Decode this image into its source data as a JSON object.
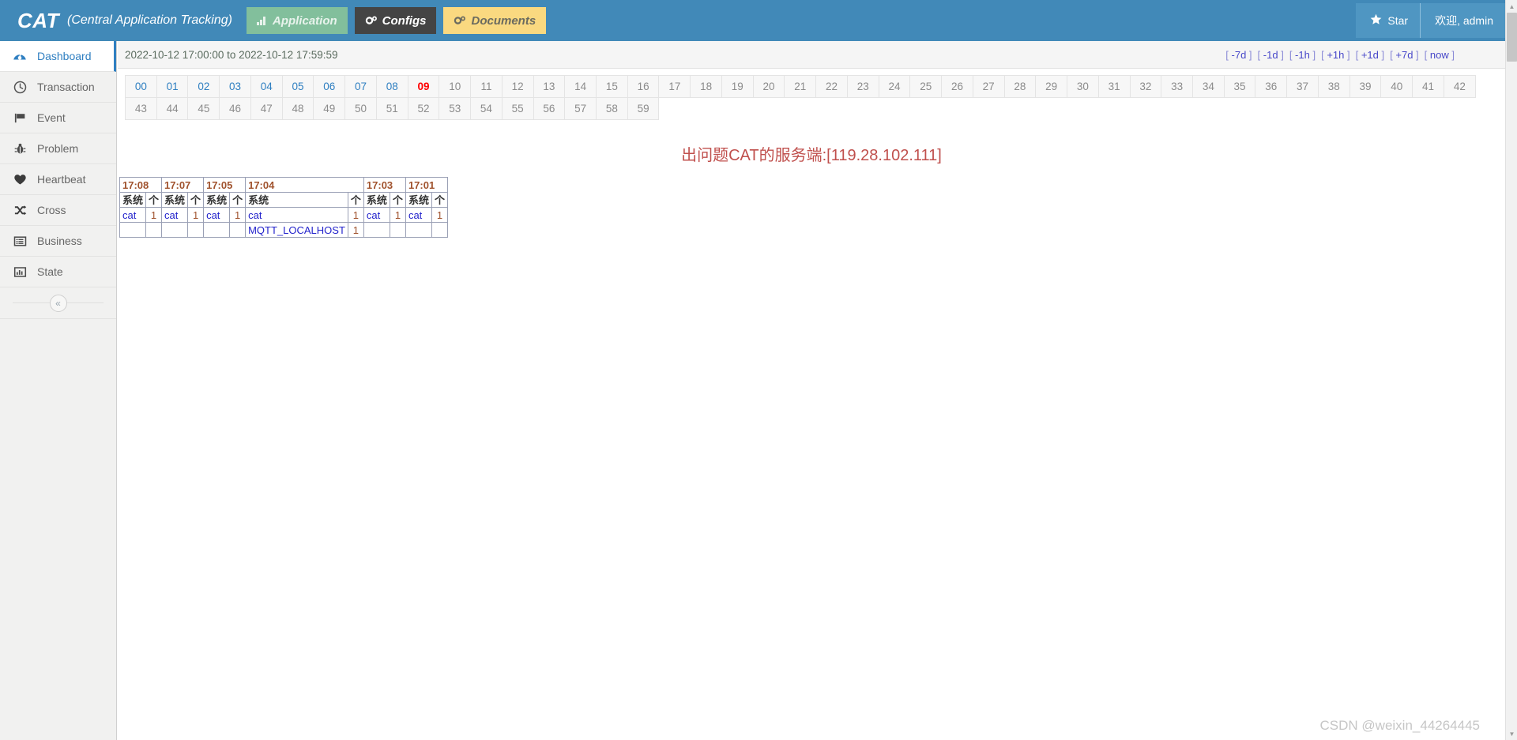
{
  "header": {
    "brand": "CAT",
    "brand_sub": "(Central Application Tracking)",
    "tabs": [
      {
        "label": "Application",
        "icon": "bar-chart-icon",
        "bg": "#82bf9c",
        "fg": "#e8f3ec"
      },
      {
        "label": "Configs",
        "icon": "gears-icon",
        "bg": "#444444",
        "fg": "#ffffff"
      },
      {
        "label": "Documents",
        "icon": "gears-icon",
        "bg": "#fad980",
        "fg": "#6b6b5f"
      }
    ],
    "star_label": "Star",
    "star_icon": "star-icon",
    "user_greeting": "欢迎, admin",
    "bg": "#4189b8"
  },
  "sidebar": {
    "items": [
      {
        "label": "Dashboard",
        "icon": "dashboard-gauge-icon",
        "active": true
      },
      {
        "label": "Transaction",
        "icon": "clock-icon",
        "active": false
      },
      {
        "label": "Event",
        "icon": "flag-icon",
        "active": false
      },
      {
        "label": "Problem",
        "icon": "bug-icon",
        "active": false
      },
      {
        "label": "Heartbeat",
        "icon": "heart-icon",
        "active": false
      },
      {
        "label": "Cross",
        "icon": "shuffle-icon",
        "active": false
      },
      {
        "label": "Business",
        "icon": "list-icon",
        "active": false
      },
      {
        "label": "State",
        "icon": "bar-chart-icon",
        "active": false
      }
    ],
    "collapse_label": "«",
    "collapse_icon": "chevron-double-left-icon",
    "active_color": "#2f7fc1"
  },
  "toolbar": {
    "date_range": "2022-10-12 17:00:00 to 2022-10-12 17:59:59",
    "jump_links": [
      "-7d",
      "-1d",
      "-1h",
      "+1h",
      "+1d",
      "+7d",
      "now"
    ]
  },
  "minute_grid": {
    "row1": [
      "00",
      "01",
      "02",
      "03",
      "04",
      "05",
      "06",
      "07",
      "08",
      "09",
      "10",
      "11",
      "12",
      "13",
      "14",
      "15",
      "16",
      "17",
      "18",
      "19",
      "20",
      "21",
      "22",
      "23",
      "24",
      "25",
      "26",
      "27",
      "28",
      "29",
      "30",
      "31",
      "32",
      "33",
      "34",
      "35",
      "36",
      "37",
      "38",
      "39",
      "40",
      "41",
      "42"
    ],
    "row2": [
      "43",
      "44",
      "45",
      "46",
      "47",
      "48",
      "49",
      "50",
      "51",
      "52",
      "53",
      "54",
      "55",
      "56",
      "57",
      "58",
      "59"
    ],
    "link_minutes": [
      "00",
      "01",
      "02",
      "03",
      "04",
      "05",
      "06",
      "07",
      "08"
    ],
    "current_minute": "09",
    "columns": 43,
    "link_color": "#2f7fc1",
    "current_color": "#ff0000",
    "inactive_color": "#8b8b8b"
  },
  "message": {
    "error_text": "出问题CAT的服务端:[119.28.102.111]",
    "color": "#c0504d"
  },
  "report": {
    "col_sys_header": "系统",
    "col_count_header": "个",
    "groups": [
      {
        "time": "17:08",
        "rows": [
          {
            "name": "cat",
            "count": "1"
          }
        ]
      },
      {
        "time": "17:07",
        "rows": [
          {
            "name": "cat",
            "count": "1"
          }
        ]
      },
      {
        "time": "17:05",
        "rows": [
          {
            "name": "cat",
            "count": "1"
          }
        ]
      },
      {
        "time": "17:04",
        "rows": [
          {
            "name": "cat",
            "count": "1"
          },
          {
            "name": "MQTT_LOCALHOST",
            "count": "1"
          }
        ]
      },
      {
        "time": "17:03",
        "rows": [
          {
            "name": "cat",
            "count": "1"
          }
        ]
      },
      {
        "time": "17:01",
        "rows": [
          {
            "name": "cat",
            "count": "1"
          }
        ]
      }
    ]
  },
  "watermark": {
    "text": "CSDN @weixin_44264445"
  },
  "scrollbar": {
    "up_icon": "triangle-up-icon",
    "down_icon": "triangle-down-icon"
  }
}
